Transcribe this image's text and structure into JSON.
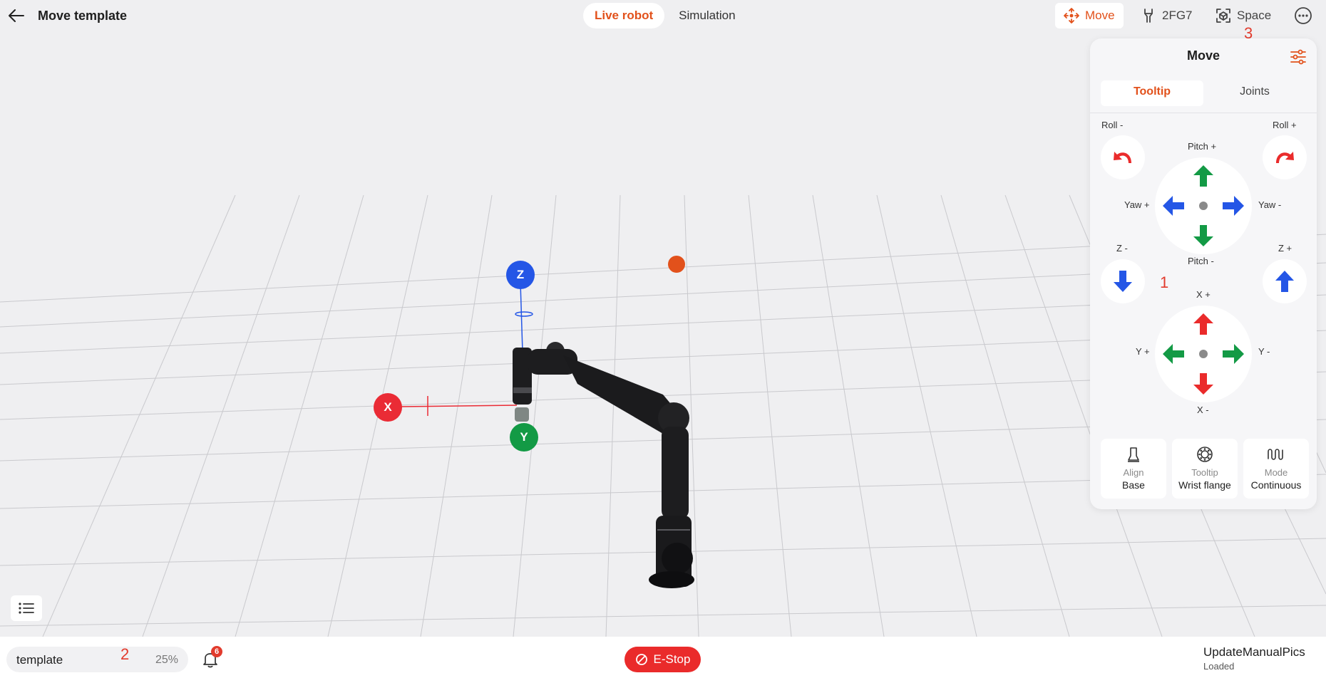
{
  "header": {
    "title": "Move template",
    "modes": [
      {
        "label": "Live robot",
        "active": true
      },
      {
        "label": "Simulation",
        "active": false
      }
    ],
    "move_label": "Move",
    "gripper_label": "2FG7",
    "space_label": "Space",
    "annotation": "3"
  },
  "scene": {
    "axis_x": "X",
    "axis_y": "Y",
    "axis_z": "Z",
    "colors": {
      "x": "#ea2b35",
      "y": "#139a45",
      "z": "#2456e6",
      "target": "#e2511b"
    }
  },
  "panel": {
    "title": "Move",
    "tabs": [
      {
        "label": "Tooltip",
        "active": true
      },
      {
        "label": "Joints",
        "active": false
      }
    ],
    "labels": {
      "roll_minus": "Roll -",
      "roll_plus": "Roll +",
      "pitch_plus": "Pitch +",
      "pitch_minus": "Pitch -",
      "yaw_plus": "Yaw +",
      "yaw_minus": "Yaw -",
      "z_minus": "Z -",
      "z_plus": "Z +",
      "x_plus": "X +",
      "x_minus": "X -",
      "y_plus": "Y +",
      "y_minus": "Y -"
    },
    "annotation": "1",
    "cards": [
      {
        "caption": "Align",
        "value": "Base",
        "icon": "bell-shape-icon"
      },
      {
        "caption": "Tooltip",
        "value": "Wrist flange",
        "icon": "flange-icon"
      },
      {
        "caption": "Mode",
        "value": "Continuous",
        "icon": "wave-icon"
      }
    ]
  },
  "footer": {
    "program": "template",
    "annotation": "2",
    "speed": "25%",
    "notifications": "6",
    "estop_label": "E-Stop",
    "robot_name": "UpdateManualPics",
    "robot_status": "Loaded"
  }
}
